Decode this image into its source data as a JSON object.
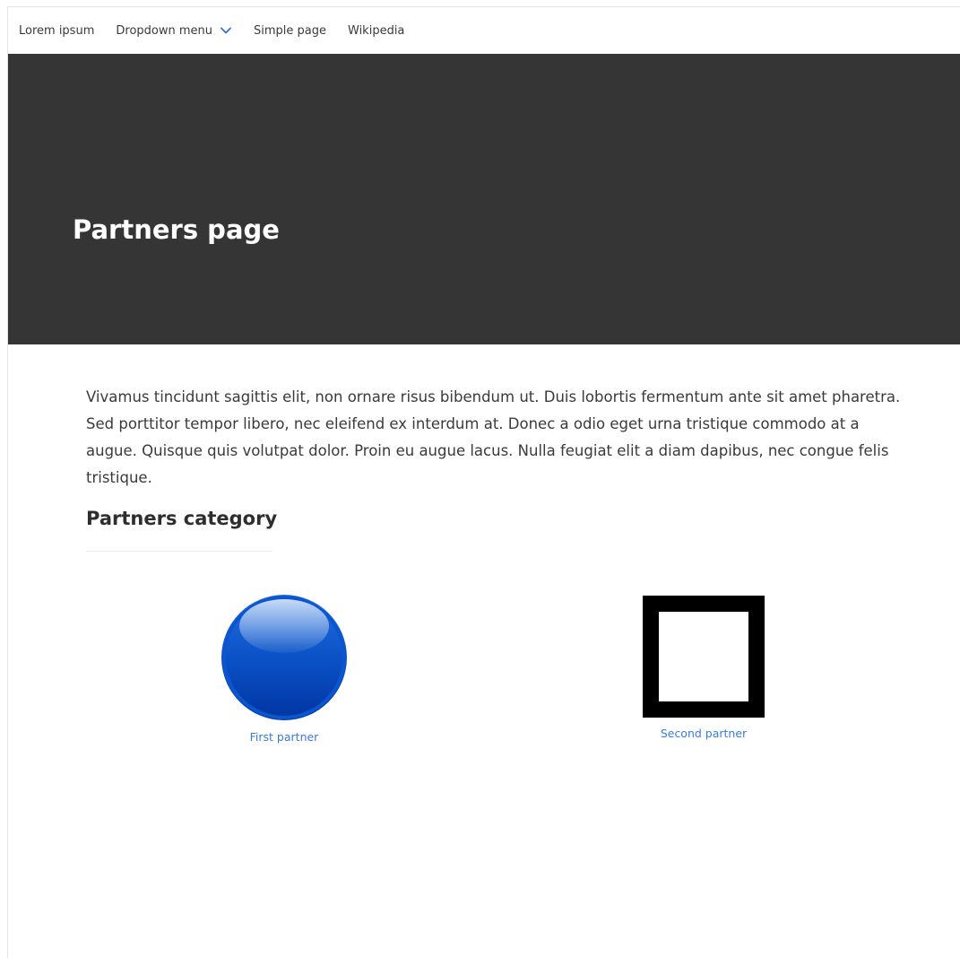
{
  "nav": {
    "items": [
      {
        "label": "Lorem ipsum"
      },
      {
        "label": "Dropdown menu",
        "icon": "chevron-down-icon"
      },
      {
        "label": "Simple page"
      },
      {
        "label": "Wikipedia"
      }
    ]
  },
  "hero": {
    "title": "Partners page",
    "background": "#353535"
  },
  "main": {
    "intro": "Vivamus tincidunt sagittis elit, non ornare risus bibendum ut. Duis lobortis fermentum ante sit amet pharetra. Sed porttitor tempor libero, nec eleifend ex interdum at. Donec a odio eget urna tristique commodo at a augue. Quisque quis volutpat dolor. Proin eu augue lacus. Nulla feugiat elit a diam dapibus, nec congue felis tristique.",
    "category_title": "Partners category",
    "partners": [
      {
        "label": "First partner",
        "logo": "blue-circle-logo"
      },
      {
        "label": "Second partner",
        "logo": "black-square-logo"
      }
    ]
  },
  "colors": {
    "link": "#3b7ae0",
    "accent_chevron": "#3b6fd8"
  }
}
